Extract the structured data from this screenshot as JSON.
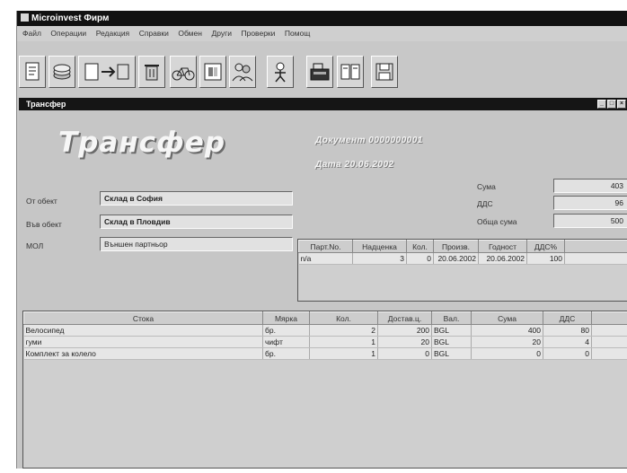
{
  "app": {
    "title": "Microinvest Фирм"
  },
  "menu": [
    "Файл",
    "Операции",
    "Редакция",
    "Справки",
    "Обмен",
    "Други",
    "Проверки",
    "Помощ"
  ],
  "toolbar": [
    {
      "icon": "document-icon"
    },
    {
      "icon": "coins-icon"
    },
    {
      "icon": "transfer-icon"
    },
    {
      "icon": "trash-icon"
    },
    {
      "icon": "bicycle-icon"
    },
    {
      "icon": "warehouse-icon"
    },
    {
      "icon": "people-icon"
    },
    {
      "icon": "person-icon"
    },
    {
      "icon": "cash-register-icon"
    },
    {
      "icon": "book-icon"
    },
    {
      "icon": "save-icon"
    }
  ],
  "window": {
    "title": "Трансфер",
    "min": "_",
    "max": "□",
    "close": "×"
  },
  "form": {
    "heading": "Трансфер",
    "document_line": "Документ 0000000001",
    "date_line": "Дата 20.06.2002",
    "from_label": "От обект",
    "from_value": "Склад в София",
    "to_label": "Във обект",
    "to_value": "Склад в Пловдив",
    "mol_label": "МОЛ",
    "mol_value": "Външен партньор"
  },
  "totals": {
    "sum_label": "Сума",
    "sum_value": "403",
    "vat_label": "ДДС",
    "vat_value": "96",
    "total_label": "Обща сума",
    "total_value": "500"
  },
  "docs_table": {
    "columns": [
      "Парт.No.",
      "Надценка",
      "Кол.",
      "Произв.",
      "Годност",
      "ДДС%"
    ],
    "rows": [
      [
        "n/a",
        "3",
        "0",
        "20.06.2002",
        "20.06.2002",
        "100"
      ]
    ]
  },
  "items_table": {
    "columns": [
      "Стока",
      "Мярка",
      "Кол.",
      "Достав.ц.",
      "Вал.",
      "Сума",
      "ДДС"
    ],
    "rows": [
      [
        "Велосипед",
        "бр.",
        "2",
        "200",
        "BGL",
        "400",
        "80"
      ],
      [
        "гуми",
        "чифт",
        "1",
        "20",
        "BGL",
        "20",
        "4"
      ],
      [
        "Комплект за колело",
        "бр.",
        "1",
        "0",
        "BGL",
        "0",
        "0"
      ]
    ]
  }
}
